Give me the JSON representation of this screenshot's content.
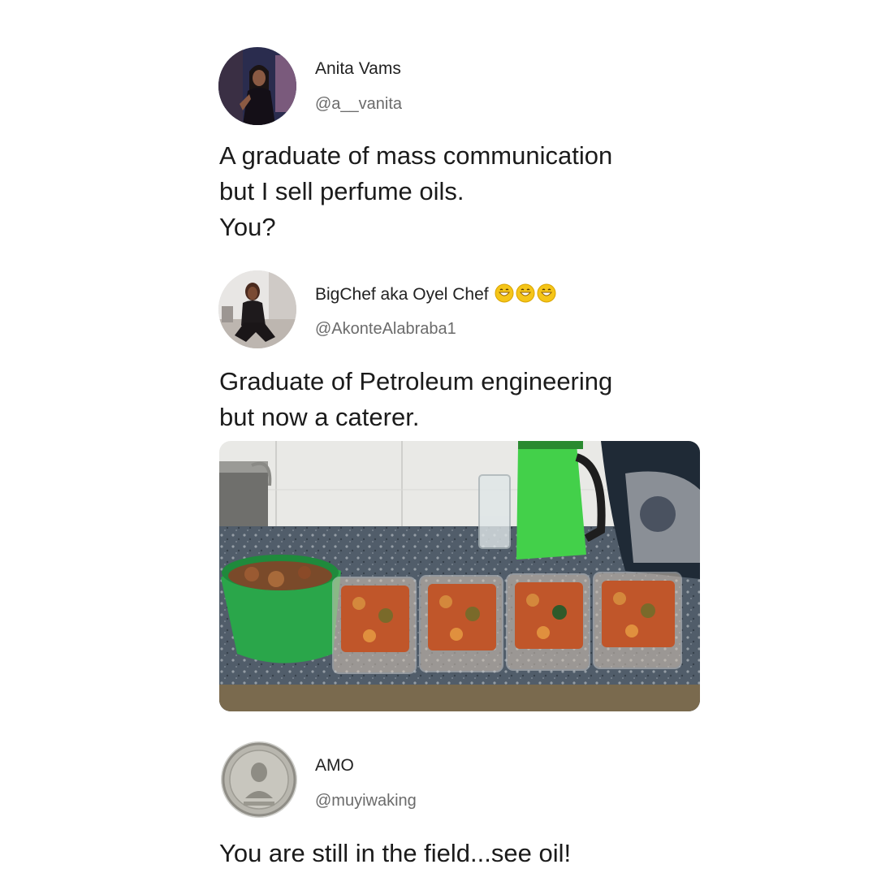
{
  "tweets": [
    {
      "name": "Anita Vams",
      "handle": "@a__vanita",
      "text_lines": [
        "A graduate of mass communication",
        "but I sell perfume oils.",
        "You?"
      ],
      "avatar": "profile-photo-woman-dark-dress"
    },
    {
      "name": "BigChef aka Oyel Chef",
      "name_emojis": [
        "grinning-face-emoji",
        "grinning-face-emoji",
        "grinning-face-emoji"
      ],
      "handle": "@AkonteAlabraba1",
      "text_lines": [
        "Graduate of Petroleum engineering",
        "but now a caterer."
      ],
      "avatar": "profile-photo-woman-seated",
      "media": "photo-food-containers-on-kitchen-counter"
    },
    {
      "name": "AMO",
      "handle": "@muyiwaking",
      "text_lines": [
        "You are still in the field...see oil!"
      ],
      "avatar": "silver-coin-portrait"
    }
  ],
  "colors": {
    "background": "#ffffff",
    "text": "#1b1b1b",
    "handle": "#6b6b6b",
    "emoji": "#f5c518"
  }
}
